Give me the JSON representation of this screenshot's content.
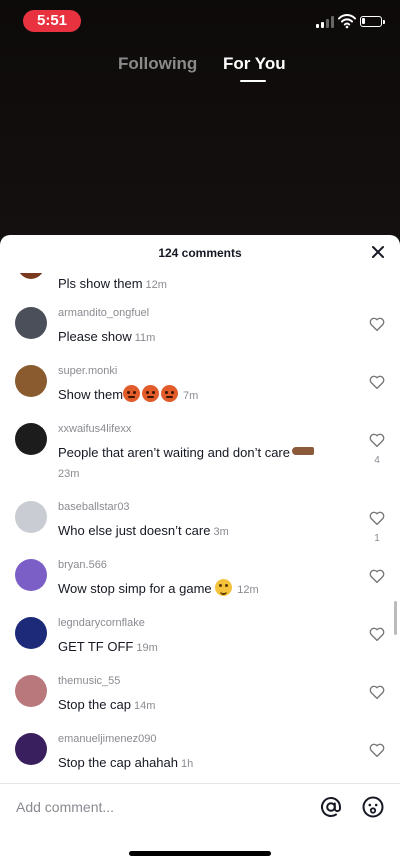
{
  "status_bar": {
    "time": "5:51"
  },
  "top_tabs": {
    "following": "Following",
    "for_you": "For You"
  },
  "sheet": {
    "comment_count": "124 comments"
  },
  "partial_comment": {
    "text": "Pls show them",
    "timestamp": "12m"
  },
  "comments": [
    {
      "username": "armandito_ongfuel",
      "text": "Please show",
      "timestamp": "11m",
      "likes": "",
      "avatar_color": "#4a4f5a"
    },
    {
      "username": "super.monki",
      "text": "Show them",
      "timestamp": "7m",
      "likes": "",
      "avatar_color": "#8a5b2e"
    },
    {
      "username": "xxwaifus4lifexx",
      "text": "People that aren’t waiting and don’t care",
      "timestamp": "23m",
      "likes": "4",
      "avatar_color": "#1c1c1c"
    },
    {
      "username": "baseballstar03",
      "text": "Who else just doesn’t care",
      "timestamp": "3m",
      "likes": "1",
      "avatar_color": "#c9ccd2"
    },
    {
      "username": "bryan.566",
      "text": "Wow stop simp for a game",
      "timestamp": "12m",
      "likes": "",
      "avatar_color": "#7b5fc7"
    },
    {
      "username": "legndarycornflake",
      "text": "GET TF OFF",
      "timestamp": "19m",
      "likes": "",
      "avatar_color": "#1d2a7a"
    },
    {
      "username": "themusic_55",
      "text": "Stop the cap",
      "timestamp": "14m",
      "likes": "",
      "avatar_color": "#b9787c"
    },
    {
      "username": "emanueljimenez090",
      "text": "Stop the cap ahahah",
      "timestamp": "1h",
      "likes": "",
      "avatar_color": "#3a1f5e"
    }
  ],
  "input": {
    "placeholder": "Add comment..."
  },
  "icons": {
    "close": "close-icon",
    "like": "heart-outline-icon",
    "mention": "at-sign-icon",
    "emoji": "emoji-face-icon"
  },
  "colors": {
    "accent_red": "#e8323f",
    "text_primary": "#161823",
    "text_secondary": "#8a8b91"
  }
}
